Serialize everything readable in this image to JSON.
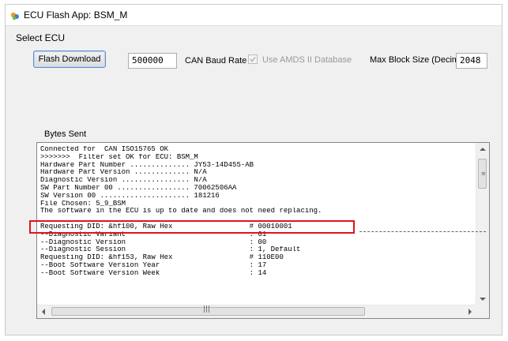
{
  "window": {
    "title": "ECU Flash App: BSM_M",
    "icon": "app-icon"
  },
  "menu": {
    "select_ecu": "Select ECU"
  },
  "controls": {
    "flash_download_label": "Flash Download",
    "baud_rate_value": "500000",
    "baud_rate_label": "CAN Baud Rate",
    "use_amds_label": "Use AMDS II Database",
    "use_amds_checked": true,
    "use_amds_enabled": false,
    "max_block_label": "Max Block Size (Decimal)",
    "max_block_value": "2048",
    "bytes_sent_label": "Bytes Sent"
  },
  "log": {
    "lines": [
      "Connected for  CAN ISO15765 OK",
      ">>>>>>>  Filter set OK for ECU: BSM_M",
      "Hardware Part Number .............. JY53-14D455-AB",
      "Hardware Part Version ............. N/A",
      "Diagnostic Version ................ N/A",
      "SW Part Number 00 ................. 70062506AA",
      "SW Version 00 ..................... 181216",
      "File Chosen: 5_9_BSM",
      "The software in the ECU is up to date and does not need replacing.",
      "",
      "Requesting DID: &hf100, Raw Hex                  # 00010001",
      "--Diagnostic Variant                             : 01",
      "--Diagnostic Version                             : 00",
      "--Diagnostic Session                             : 1, Default",
      "Requesting DID: &hf153, Raw Hex                  # 110E00",
      "--Boot Software Version Year                     : 17",
      "--Boot Software Version Week                     : 14"
    ],
    "highlighted_line_index": 8
  },
  "scrollbars": {
    "horizontal_grip": "|||",
    "vertical_grip": "≡"
  },
  "colors": {
    "highlight_border": "#e0141e",
    "button_border": "#5f8fc8",
    "window_bg": "#f0f0f0"
  }
}
